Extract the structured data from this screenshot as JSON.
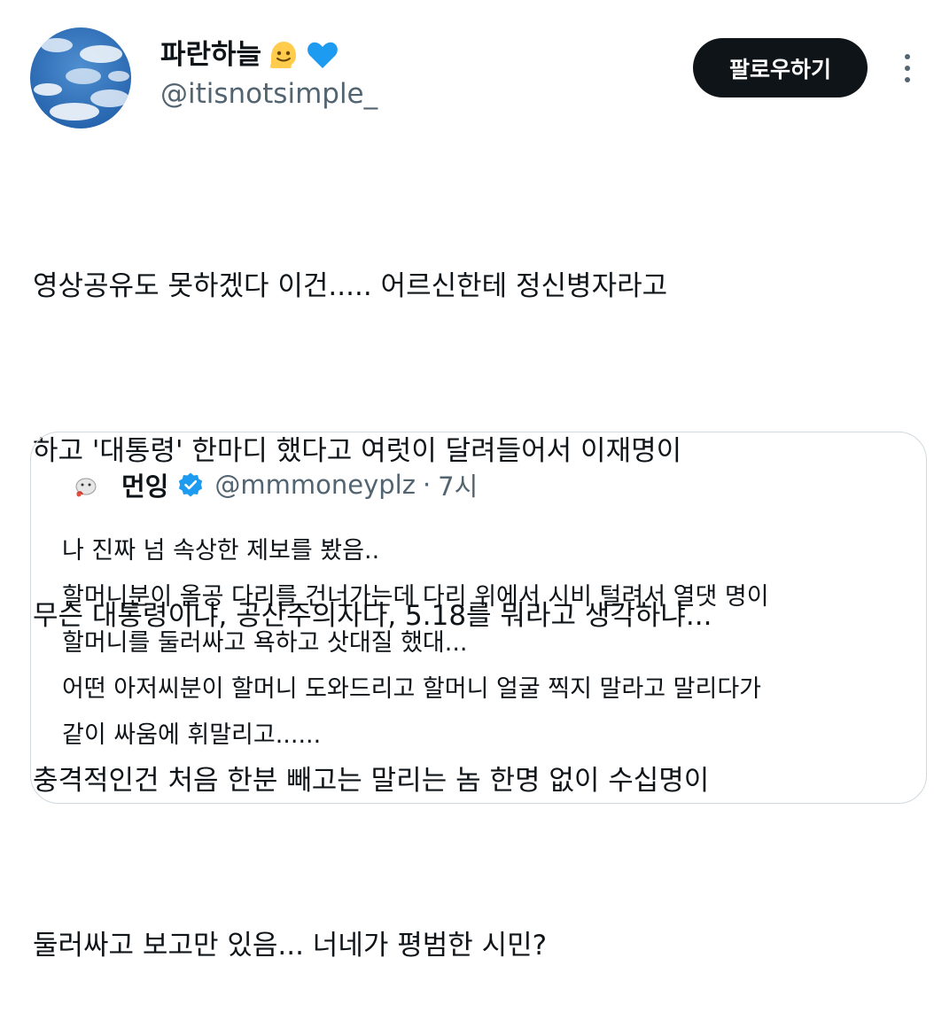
{
  "author": {
    "display_name": "파란하늘",
    "handle": "@itisnotsimple_",
    "avatar_icon": "sky-clouds-avatar",
    "emoji_icons": [
      "melting-face-emoji",
      "blue-heart-emoji"
    ]
  },
  "actions": {
    "follow_label": "팔로우하기",
    "more_icon": "more-vertical-icon"
  },
  "tweet": {
    "lines": [
      "영상공유도 못하겠다 이건..... 어르신한테 정신병자라고",
      "하고 '대통령' 한마디 했다고 여럿이 달려들어서 이재명이",
      "무슨 대통령이냐, 공산주의자다, 5.18를 뭐라고 생각하냐...",
      "충격적인건 처음 한분 빼고는 말리는 놈 한명 없이 수십명이",
      "둘러싸고 보고만 있음... 너네가 평범한 시민?"
    ]
  },
  "quote": {
    "display_name": "먼잉",
    "handle": "@mmmoneyplz",
    "separator": "·",
    "time": "7시",
    "verified_icon": "verified-badge-icon",
    "lines": [
      "나 진짜 넘 속상한 제보를 봤음..",
      "할머니분이 올공 다리를 건너가는데 다리 위에서 시비 털려서 열댓 명이",
      "할머니를 둘러싸고 욕하고 삿대질 했대...",
      "어떤 아저씨분이 할머니 도와드리고 할머니 얼굴 찍지 말라고 말리다가",
      "같이 싸움에 휘말리고......"
    ]
  },
  "colors": {
    "text": "#0f1419",
    "secondary": "#536471",
    "border": "#cfd9de",
    "verified": "#1d9bf0",
    "follow_bg": "#0f1419"
  }
}
